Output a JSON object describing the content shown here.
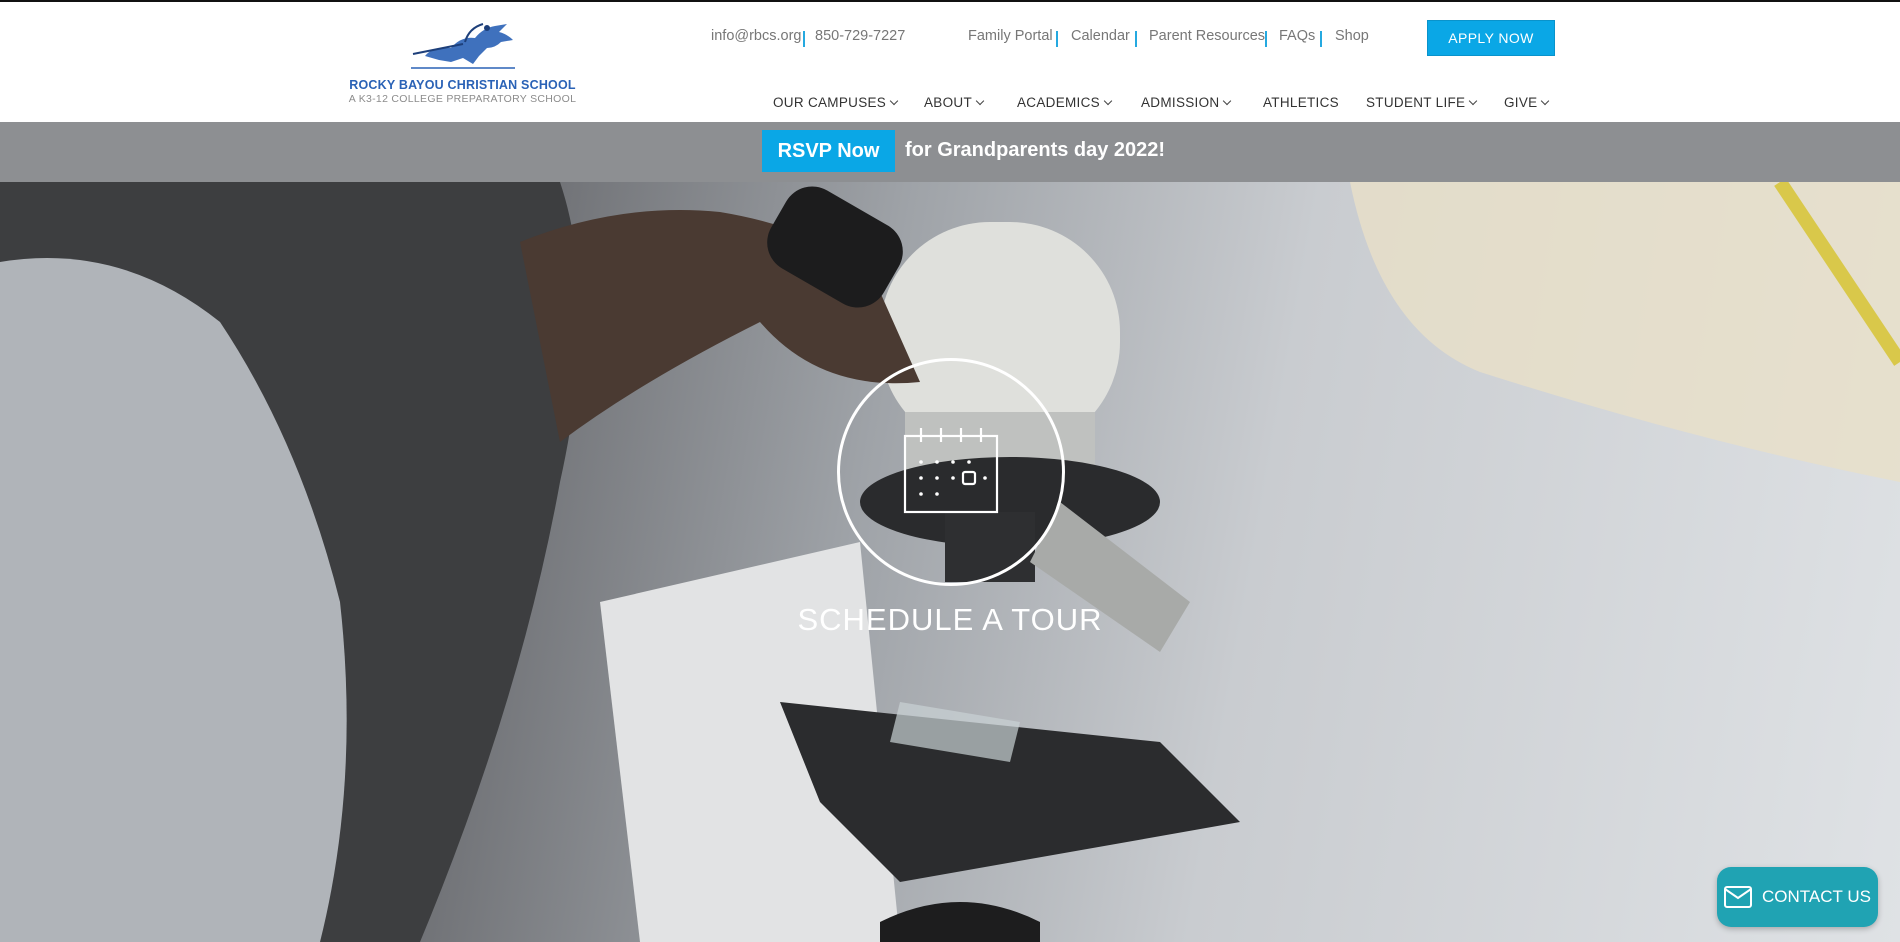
{
  "header": {
    "logo": {
      "name": "ROCKY BAYOU CHRISTIAN SCHOOL",
      "tagline": "A K3-12 COLLEGE PREPARATORY SCHOOL",
      "icon": "knight-on-horse-logo"
    },
    "contact": {
      "email": "info@rbcs.org",
      "phone": "850-729-7227"
    },
    "utility_links": [
      "Family Portal",
      "Calendar",
      "Parent Resources",
      "FAQs",
      "Shop"
    ],
    "apply_label": "APPLY NOW",
    "nav": [
      "OUR CAMPUSES",
      "ABOUT",
      "ACADEMICS",
      "ADMISSION",
      "ATHLETICS",
      "STUDENT LIFE",
      "GIVE"
    ]
  },
  "promo": {
    "button_label": "RSVP Now",
    "text": "for Grandparents day 2022!"
  },
  "hero": {
    "icon": "calendar-icon",
    "label": "SCHEDULE A TOUR"
  },
  "contact_widget": {
    "icon": "envelope-icon",
    "label": "CONTACT US"
  },
  "colors": {
    "accent": "#0aa7e6",
    "promo_bar": "#8d8f92",
    "logo_blue": "#2a62b6",
    "contact_teal": "#20a3b3"
  }
}
